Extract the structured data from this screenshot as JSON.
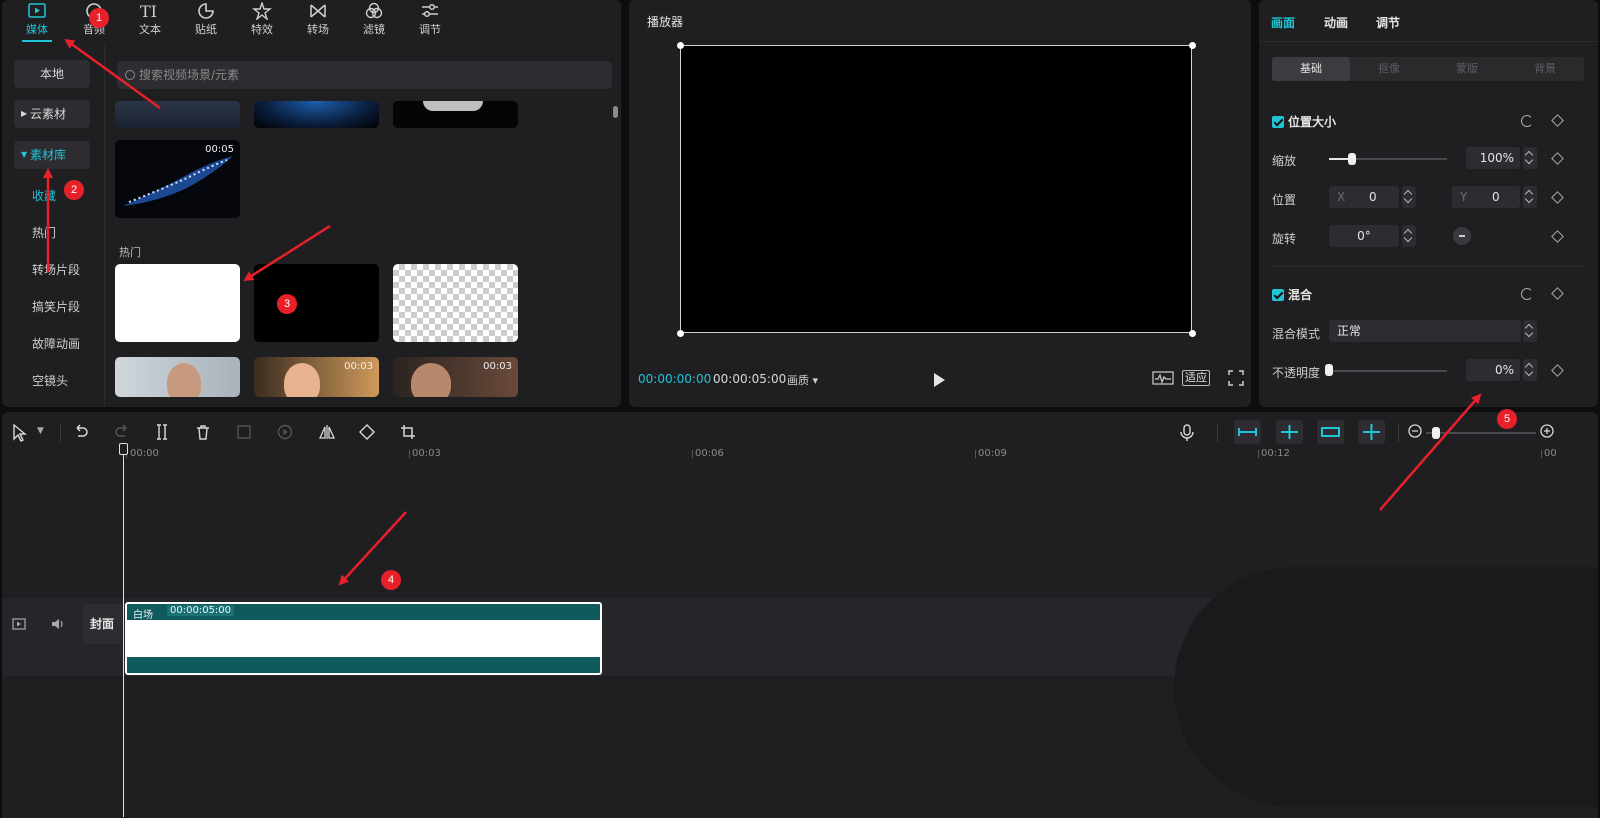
{
  "media": {
    "tabs": [
      {
        "label": "媒体",
        "icon": "media-icon",
        "active": true
      },
      {
        "label": "音频",
        "icon": "audio-icon"
      },
      {
        "label": "文本",
        "icon": "text-icon"
      },
      {
        "label": "贴纸",
        "icon": "sticker-icon"
      },
      {
        "label": "特效",
        "icon": "effects-icon"
      },
      {
        "label": "转场",
        "icon": "transition-icon"
      },
      {
        "label": "滤镜",
        "icon": "filter-icon"
      },
      {
        "label": "调节",
        "icon": "adjust-icon"
      }
    ],
    "sidebar": {
      "local": "本地",
      "cloud": "云素材",
      "library": "素材库",
      "links": [
        "收藏",
        "热门",
        "转场片段",
        "搞笑片段",
        "故障动画",
        "空镜头"
      ]
    },
    "search_placeholder": "搜索视频场景/元素",
    "thumb_duration": "00:05",
    "section_hot": "热门",
    "face_durations": [
      "00:03",
      "00:03"
    ]
  },
  "player": {
    "title": "播放器",
    "current_time": "00:00:00:00",
    "total_time": "00:00:05:00",
    "quality": "画质",
    "fit": "适应"
  },
  "props": {
    "tabs": [
      "画面",
      "动画",
      "调节"
    ],
    "subtabs": [
      "基础",
      "抠像",
      "蒙版",
      "背景"
    ],
    "pos_size": {
      "title": "位置大小",
      "scale_label": "缩放",
      "scale_value": "100%",
      "position_label": "位置",
      "x_label": "X",
      "x_value": "0",
      "y_label": "Y",
      "y_value": "0",
      "rotate_label": "旋转",
      "rotate_value": "0°"
    },
    "blend": {
      "title": "混合",
      "mode_label": "混合模式",
      "mode_value": "正常",
      "opacity_label": "不透明度",
      "opacity_value": "0%",
      "opacity_level": 0
    }
  },
  "timeline": {
    "ruler": [
      "00:00",
      "00:03",
      "00:06",
      "00:09",
      "00:12",
      "00"
    ],
    "clip_name": "白场",
    "clip_duration": "00:00:05:00",
    "cover": "封面"
  },
  "annotations": [
    "1",
    "2",
    "3",
    "4",
    "5"
  ],
  "colors": {
    "accent": "#20c4d6",
    "clip": "#0f5a5d",
    "badge": "#e8202a"
  }
}
